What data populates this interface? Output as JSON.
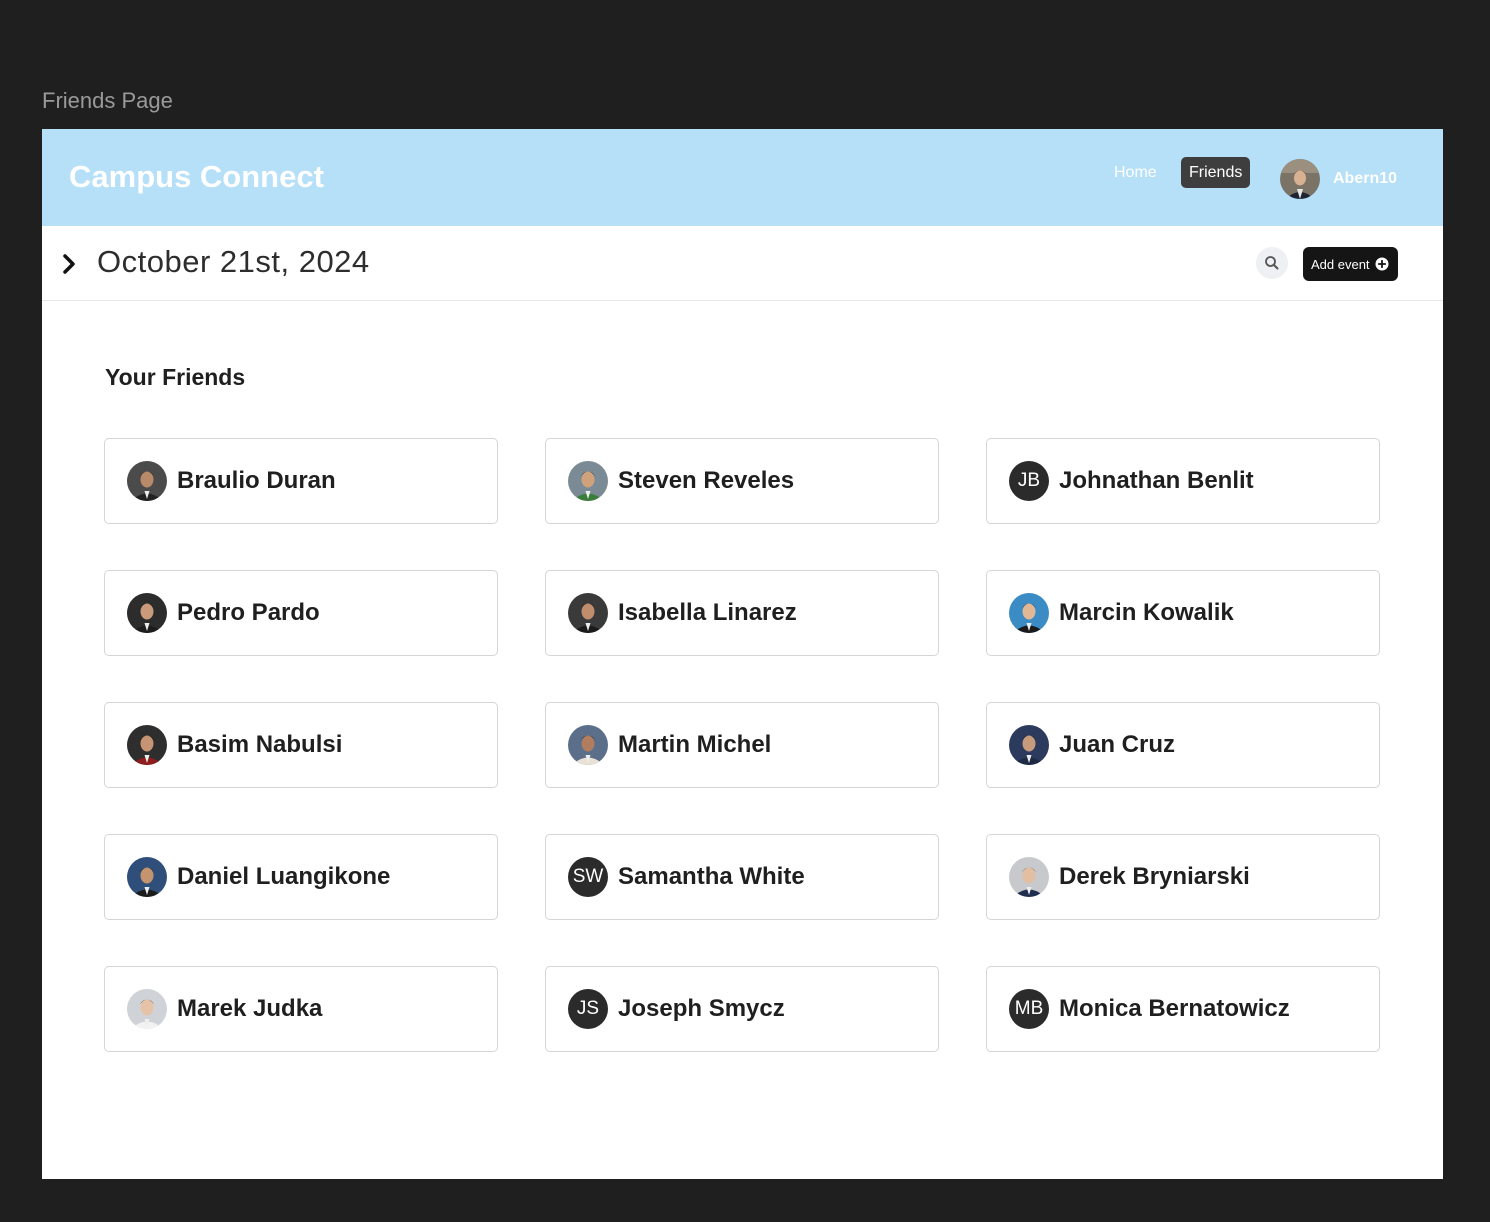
{
  "frame_label": "Friends Page",
  "header": {
    "brand": "Campus Connect",
    "nav": {
      "home": "Home",
      "friends": "Friends"
    },
    "user": {
      "name": "Abern10"
    }
  },
  "date_bar": {
    "date": "October 21st, 2024",
    "add_event_label": "Add event"
  },
  "friends_section": {
    "title": "Your Friends",
    "friends": [
      {
        "name": "Braulio Duran",
        "avatar": "photo",
        "skin": "#b98a6a",
        "bg": "#4b4b4b",
        "hair": "#1a1a1a",
        "shirt": "#222222"
      },
      {
        "name": "Steven Reveles",
        "avatar": "photo",
        "skin": "#d0a27c",
        "bg": "#7a8b95",
        "hair": "#2a2a2a",
        "shirt": "#3b7d3a"
      },
      {
        "name": "Johnathan Benlit",
        "avatar": "initials",
        "initials": "JB"
      },
      {
        "name": "Pedro Pardo",
        "avatar": "photo",
        "skin": "#c99b7a",
        "bg": "#2c2c2c",
        "hair": "#111111",
        "shirt": "#1d1d1d"
      },
      {
        "name": "Isabella Linarez",
        "avatar": "photo",
        "skin": "#c08d6d",
        "bg": "#3a3a3a",
        "hair": "#1a1410",
        "shirt": "#1b1b1b"
      },
      {
        "name": "Marcin Kowalik",
        "avatar": "photo",
        "skin": "#e1b796",
        "bg": "#3b8cc4",
        "hair": "#2a1d14",
        "shirt": "#1a1a1a"
      },
      {
        "name": "Basim Nabulsi",
        "avatar": "photo",
        "skin": "#c69473",
        "bg": "#2e2e2e",
        "hair": "#131313",
        "shirt": "#8e1d1d"
      },
      {
        "name": "Martin Michel",
        "avatar": "photo",
        "skin": "#b07d5e",
        "bg": "#5b6f8a",
        "hair": "#151515",
        "shirt": "#e8e2d6"
      },
      {
        "name": "Juan Cruz",
        "avatar": "photo",
        "skin": "#c59a7d",
        "bg": "#2c3a5e",
        "hair": "#111111",
        "shirt": "#1e2a44"
      },
      {
        "name": "Daniel Luangikone",
        "avatar": "photo",
        "skin": "#c49470",
        "bg": "#2f4f7a",
        "hair": "#0f0f0f",
        "shirt": "#1b1b1b"
      },
      {
        "name": "Samantha White",
        "avatar": "initials",
        "initials": "SW"
      },
      {
        "name": "Derek Bryniarski",
        "avatar": "photo",
        "skin": "#e2bfa2",
        "bg": "#c7c9cc",
        "hair": "#6a4b33",
        "shirt": "#1f2d4f"
      },
      {
        "name": "Marek Judka",
        "avatar": "photo",
        "skin": "#e6c3a6",
        "bg": "#cfd3d8",
        "hair": "#4a3524",
        "shirt": "#f2f2f2"
      },
      {
        "name": "Joseph Smycz",
        "avatar": "initials",
        "initials": "JS"
      },
      {
        "name": "Monica Bernatowicz",
        "avatar": "initials",
        "initials": "MB"
      }
    ]
  },
  "icons": {
    "chevron": "chevron-right-icon",
    "search": "search-icon",
    "add": "plus-circle-icon"
  },
  "colors": {
    "header_bg": "#b6dff8",
    "nav_active_bg": "#3e3e3e",
    "button_bg": "#151515",
    "initials_bg": "#2b2b2b"
  }
}
